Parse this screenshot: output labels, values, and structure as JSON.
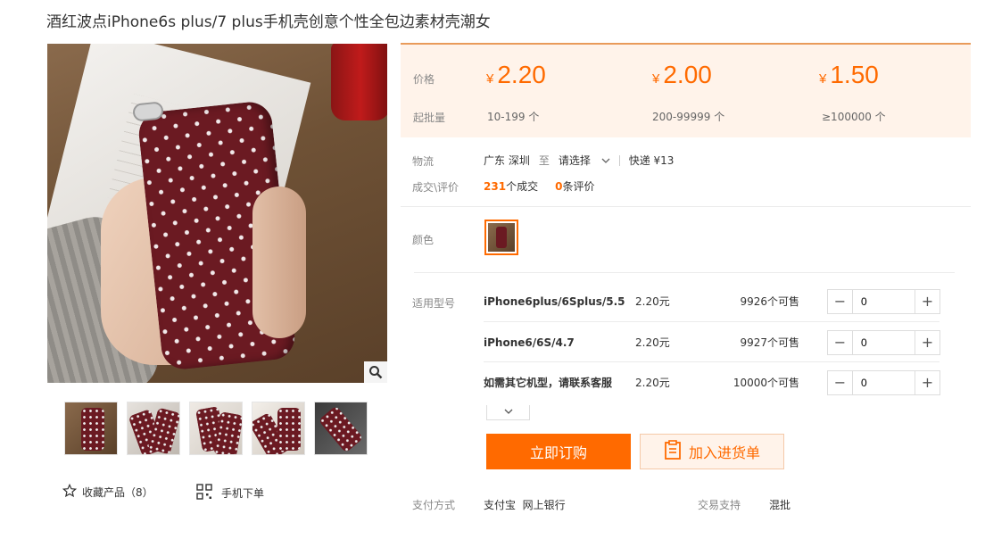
{
  "product": {
    "title": "酒红波点iPhone6s plus/7 plus手机壳创意个性全包边素材壳潮女"
  },
  "gallery": {
    "zoom_icon": "search-icon",
    "thumb_count": 5
  },
  "actions": {
    "favorite_label": "收藏产品（8）",
    "favorite_icon": "star-icon",
    "mobile_order_label": "手机下单",
    "mobile_order_icon": "qr-code-icon"
  },
  "pricing": {
    "price_label": "价格",
    "moq_label": "起批量",
    "currency": "¥",
    "tiers": [
      {
        "price": "2.20",
        "range": "10-199 个"
      },
      {
        "price": "2.00",
        "range": "200-99999 个"
      },
      {
        "price": "1.50",
        "range": "≥100000 个"
      }
    ]
  },
  "logistics": {
    "label": "物流",
    "from": "广东 深圳",
    "to_word": "至",
    "destination": "请选择",
    "express": "快递 ¥13"
  },
  "trade": {
    "label": "成交\\评价",
    "deals_count": "231",
    "deals_suffix": "个成交",
    "reviews_count": "0",
    "reviews_suffix": "条评价"
  },
  "color": {
    "label": "颜色"
  },
  "models": {
    "label": "适用型号",
    "rows": [
      {
        "name": "iPhone6plus/6Splus/5.5",
        "price": "2.20元",
        "stock": "9926个可售",
        "qty": "0"
      },
      {
        "name": "iPhone6/6S/4.7",
        "price": "2.20元",
        "stock": "9927个可售",
        "qty": "0"
      },
      {
        "name": "如需其它机型，请联系客服",
        "price": "2.20元",
        "stock": "10000个可售",
        "qty": "0"
      }
    ]
  },
  "buttons": {
    "buy_now": "立即订购",
    "add_to_list": "加入进货单"
  },
  "payment": {
    "label": "支付方式",
    "methods": "支付宝  网上银行",
    "support_label": "交易支持",
    "support_value": "混批"
  },
  "colors": {
    "accent": "#ff6a00",
    "price_bg": "#fff3ea"
  }
}
